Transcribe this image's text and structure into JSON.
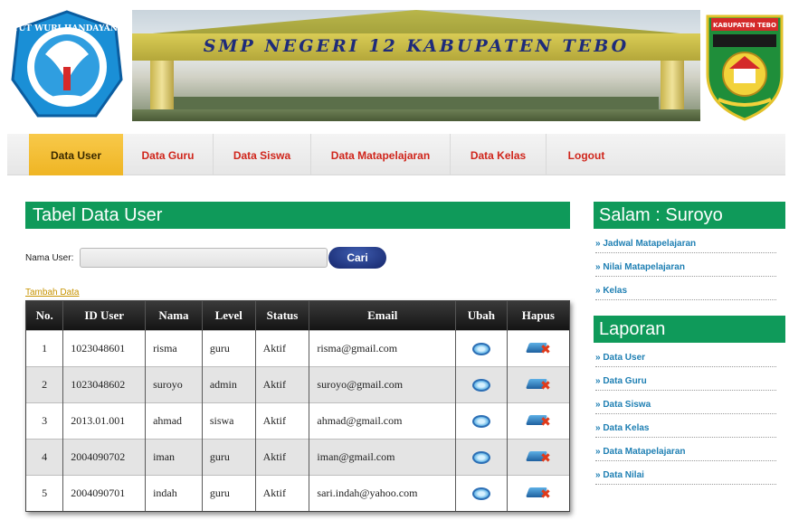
{
  "header": {
    "school_name": "SMP NEGERI 12 KABUPATEN TEBO",
    "logo_left_text": "TUT WURI HANDAYANI",
    "logo_right_text": "KABUPATEN TEBO"
  },
  "nav": {
    "items": [
      {
        "label": "Data User",
        "active": true
      },
      {
        "label": "Data Guru",
        "active": false
      },
      {
        "label": "Data Siswa",
        "active": false
      },
      {
        "label": "Data Matapelajaran",
        "active": false
      },
      {
        "label": "Data Kelas",
        "active": false
      },
      {
        "label": "Logout",
        "active": false
      }
    ]
  },
  "main": {
    "title": "Tabel Data User",
    "search_label": "Nama User:",
    "search_value": "",
    "search_button": "Cari",
    "add_link": "Tambah Data",
    "table": {
      "headers": [
        "No.",
        "ID User",
        "Nama",
        "Level",
        "Status",
        "Email",
        "Ubah",
        "Hapus"
      ],
      "rows": [
        {
          "no": "1",
          "id": "1023048601",
          "nama": "risma",
          "level": "guru",
          "status": "Aktif",
          "email": "risma@gmail.com"
        },
        {
          "no": "2",
          "id": "1023048602",
          "nama": "suroyo",
          "level": "admin",
          "status": "Aktif",
          "email": "suroyo@gmail.com"
        },
        {
          "no": "3",
          "id": "2013.01.001",
          "nama": "ahmad",
          "level": "siswa",
          "status": "Aktif",
          "email": "ahmad@gmail.com"
        },
        {
          "no": "4",
          "id": "2004090702",
          "nama": "iman",
          "level": "guru",
          "status": "Aktif",
          "email": "iman@gmail.com"
        },
        {
          "no": "5",
          "id": "2004090701",
          "nama": "indah",
          "level": "guru",
          "status": "Aktif",
          "email": "sari.indah@yahoo.com"
        }
      ]
    }
  },
  "sidebar": {
    "greeting": "Salam : Suroyo",
    "links": [
      "» Jadwal Matapelajaran",
      "» Nilai Matapelajaran",
      "» Kelas"
    ],
    "report_title": "Laporan",
    "report_links": [
      "» Data User",
      "» Data Guru",
      "» Data Siswa",
      "» Data Kelas",
      "» Data Matapelajaran",
      "» Data Nilai"
    ]
  },
  "colors": {
    "accent_green": "#0f9a5a",
    "nav_active": "#efb524",
    "nav_text": "#d0261c",
    "link_blue": "#1e7fb3"
  }
}
